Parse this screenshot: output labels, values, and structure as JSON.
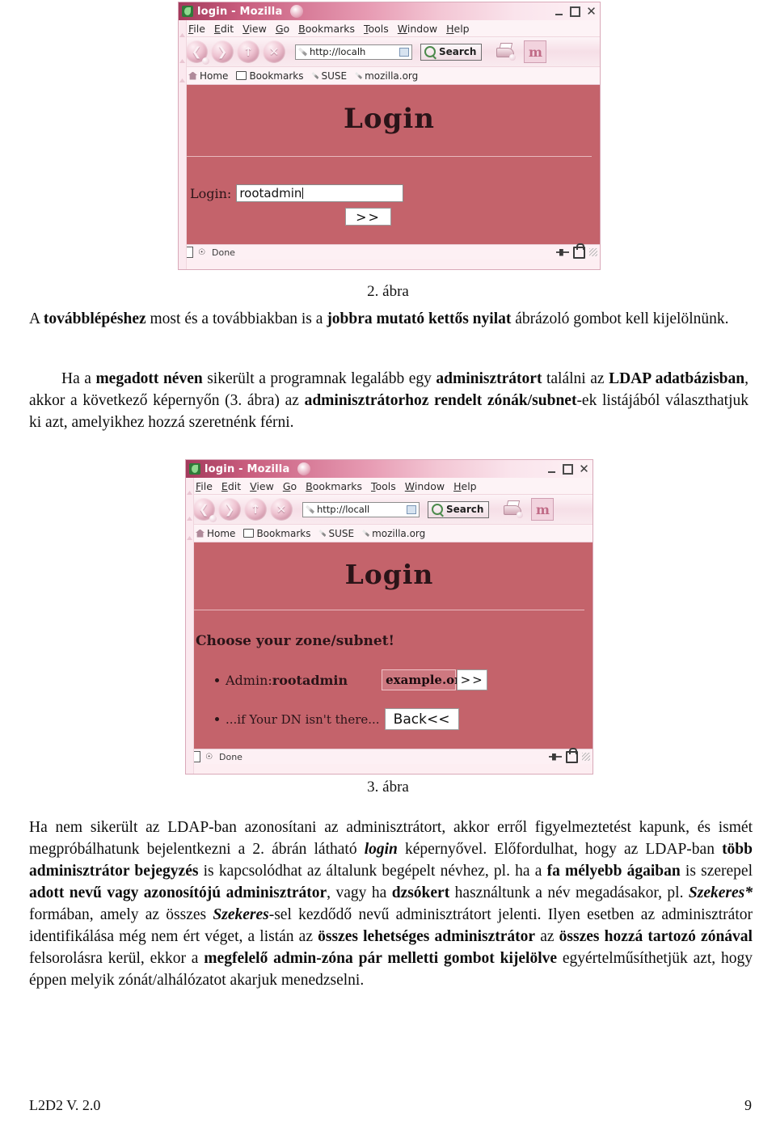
{
  "figures": [
    {
      "caption": "2. ábra",
      "window": {
        "title": "login - Mozilla",
        "app_icon": "mozilla-lizard-icon",
        "window_controls": {
          "minimize": "minimize-icon",
          "maximize": "maximize-icon",
          "close": "close-icon"
        },
        "menus": [
          "File",
          "Edit",
          "View",
          "Go",
          "Bookmarks",
          "Tools",
          "Window",
          "Help"
        ],
        "nav": {
          "back": "back-icon",
          "forward": "forward-icon",
          "reload": "reload-icon",
          "stop": "stop-icon",
          "url_value": "http://localh",
          "search_label": "Search",
          "print": "print-icon",
          "logo": "m"
        },
        "bookmarks": [
          "Home",
          "Bookmarks",
          "SUSE",
          "mozilla.org"
        ],
        "status": {
          "text": "Done",
          "security": "lock-icon",
          "connection": "plug-icon"
        }
      },
      "page": {
        "heading": "Login",
        "login_label": "Login:",
        "login_value": "rootadmin",
        "submit_label": ">>"
      }
    },
    {
      "caption": "3. ábra",
      "window": {
        "title": "login - Mozilla",
        "app_icon": "mozilla-lizard-icon",
        "window_controls": {
          "minimize": "minimize-icon",
          "maximize": "maximize-icon",
          "close": "close-icon"
        },
        "menus": [
          "File",
          "Edit",
          "View",
          "Go",
          "Bookmarks",
          "Tools",
          "Window",
          "Help"
        ],
        "nav": {
          "back": "back-icon",
          "forward": "forward-icon",
          "reload": "reload-icon",
          "stop": "stop-icon",
          "url_value": "http://locall",
          "search_label": "Search",
          "print": "print-icon",
          "logo": "m"
        },
        "bookmarks": [
          "Home",
          "Bookmarks",
          "SUSE",
          "mozilla.org"
        ],
        "status": {
          "text": "Done",
          "security": "lock-icon",
          "connection": "plug-icon"
        }
      },
      "page": {
        "heading": "Login",
        "prompt": "Choose your zone/subnet!",
        "row1_prefix": "Admin: ",
        "row1_admin": "rootadmin",
        "zone_value": "example.org",
        "submit_label": ">>",
        "row2_text": "...if Your DN isn't there...",
        "back_label": "Back<<"
      }
    }
  ],
  "paragraphs": {
    "p1": {
      "s1": "A ",
      "b1": "továbblépéshez",
      "s2": " most és a továbbiakban is a ",
      "b2": "jobbra mutató kettős nyilat",
      "s3": " ábrázoló gombot kell kijelölnünk."
    },
    "p2": {
      "s1": "Ha a ",
      "b1": "megadott néven",
      "s2": " sikerült a programnak legalább egy ",
      "b2": "adminisztrátort",
      "s3": " találni az ",
      "b3": "LDAP adatbázisban",
      "s4": ", akkor a következő képernyőn (3. ábra) az ",
      "b4": "adminisztrátorhoz rendelt zónák/subnet",
      "s5": "-ek listájából választhatjuk ki azt, amelyikhez hozzá szeretnénk férni."
    },
    "p3": {
      "s1": "Ha nem sikerült az LDAP-ban azonosítani az adminisztrátort, akkor erről figyelmeztetést kapunk, és ismét megpróbálhatunk bejelentkezni a 2. ábrán látható ",
      "i1": "login",
      "s2": " képernyővel.  Előfordulhat, hogy az LDAP-ban ",
      "b1": "több adminisztrátor bejegyzés",
      "s3": " is kapcsolódhat az általunk begépelt névhez, pl. ha a ",
      "b2": "fa mélyebb ágaiban",
      "s4": " is szerepel ",
      "b3": "adott nevű vagy azonosítójú adminisztrátor",
      "s5": ", vagy ha ",
      "b4": "dzsókert",
      "s6": " használtunk a név megadásakor, pl. ",
      "bi1": "Szekeres*",
      "s7": " formában, amely az összes ",
      "bi2": "Szekeres",
      "s8": "-sel kezdődő nevű adminisztrátort jelenti.  Ilyen esetben az adminisztrátor identifikálása még nem ért véget, a listán az ",
      "b5": "összes lehetséges adminisztrátor",
      "s9": " az ",
      "b6": "összes hozzá tartozó zónával",
      "s10": " felsorolásra kerül, ekkor a ",
      "b7": "megfelelő admin-zóna pár melletti gombot kijelölve",
      "s11": " egyértelműsíthetjük azt, hogy éppen melyik zónát/alhálózatot akarjuk menedzselni."
    }
  },
  "footer": {
    "left": "L2D2 V. 2.0",
    "right": "9"
  }
}
